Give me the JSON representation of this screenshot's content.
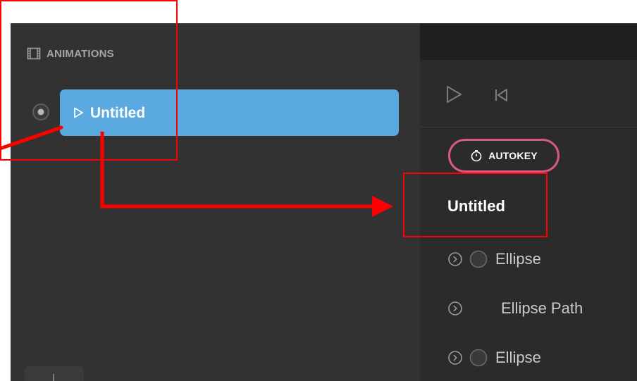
{
  "left_panel": {
    "header_title": "ANIMATIONS",
    "animation_label": "Untitled"
  },
  "right_panel": {
    "autokey_label": "AUTOKEY",
    "timeline_title": "Untitled",
    "layers": [
      {
        "label": "Ellipse"
      },
      {
        "label": "Ellipse Path"
      },
      {
        "label": "Ellipse"
      }
    ]
  },
  "colors": {
    "accent_blue": "#5aa9e0",
    "autokey_border": "#d55a87",
    "annotation_red": "#ff0000"
  },
  "icons": {
    "film": "film-icon",
    "radio": "radio-icon",
    "play_outline": "play-outline-icon",
    "play": "play-icon",
    "rewind": "skip-back-icon",
    "stopwatch": "stopwatch-icon",
    "expand": "chevron-right-circle-icon",
    "ellipse": "ellipse-icon"
  }
}
